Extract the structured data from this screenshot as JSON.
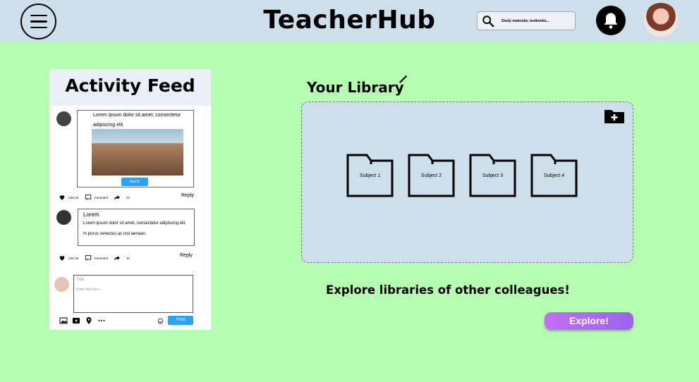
{
  "header": {
    "title": "TeacherHub",
    "search_placeholder": "Study materials, textbooks...",
    "menu_icon": "hamburger-menu-icon",
    "bell_icon": "bell-icon"
  },
  "feed": {
    "title": "Activity Feed",
    "post1": {
      "text": "Lorem ipsum dolor sit amet, consectetur adipiscing elit.",
      "button": "See it!",
      "like": "Like 24",
      "comment": "Comment",
      "shares": "24",
      "reply": "Reply"
    },
    "post2": {
      "title": "Lorem",
      "text": "Lorem ipsum dolor sit amet, consectetur adipiscing elit. In purus senectus ac nisl aenean.",
      "like": "Like 24",
      "comment": "Comment",
      "shares": "10",
      "reply": "Reply"
    },
    "compose": {
      "title_placeholder": "Title",
      "body_placeholder": "Enter text here...",
      "post_button": "Post"
    }
  },
  "library": {
    "title": "Your Library",
    "folders": [
      "Subject 1",
      "Subject 2",
      "Subject 3",
      "Subject 4"
    ]
  },
  "explore": {
    "text": "Explore libraries of other colleagues!",
    "button": "Explore!"
  },
  "colors": {
    "background": "#b5fdb1",
    "header": "#cddfeb",
    "accent_blue": "#2aa3f6",
    "explore_purple": "#b26bf1"
  }
}
